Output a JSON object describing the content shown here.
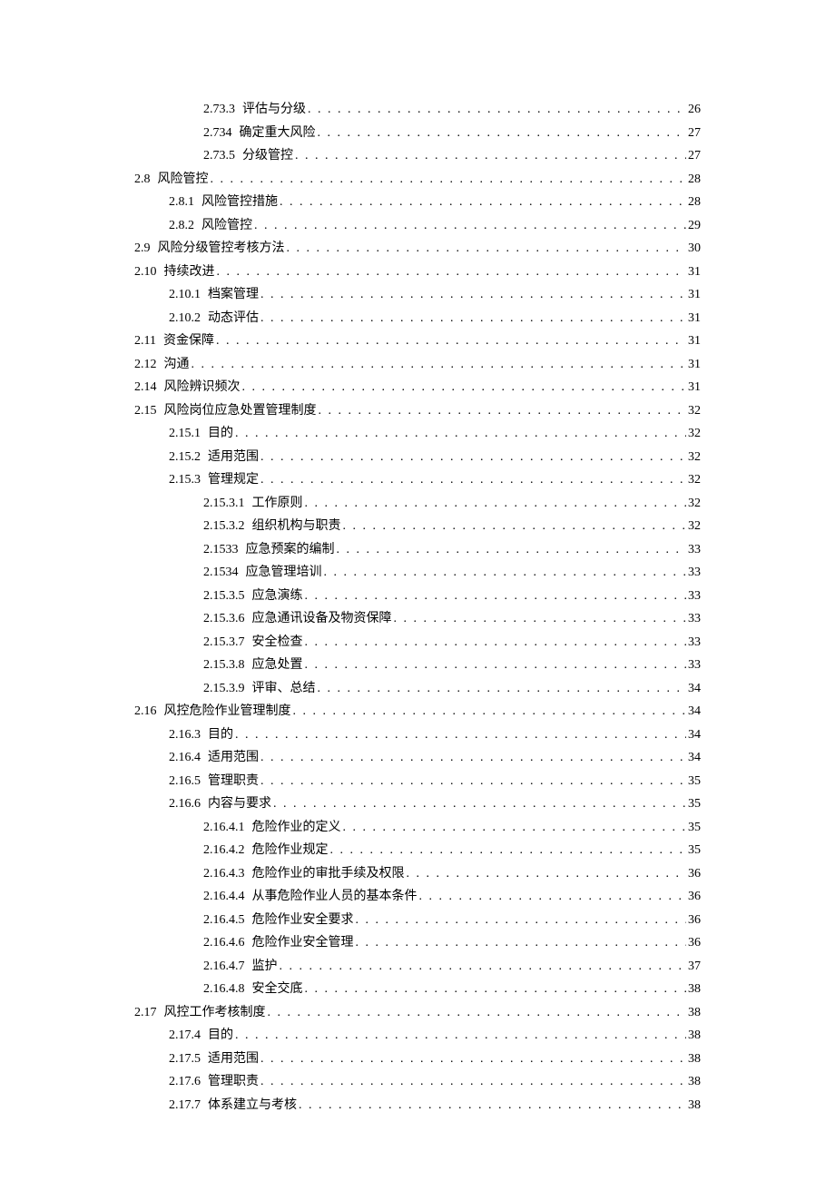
{
  "toc": [
    {
      "indent": 3,
      "num": "2.73.3",
      "title": "评估与分级",
      "page": "26"
    },
    {
      "indent": 3,
      "num": "2.734",
      "title": "确定重大风险",
      "page": "27"
    },
    {
      "indent": 3,
      "num": "2.73.5",
      "title": "分级管控",
      "page": "27"
    },
    {
      "indent": 1,
      "num": "2.8",
      "title": "风险管控",
      "page": "28"
    },
    {
      "indent": 2,
      "num": "2.8.1",
      "title": "风险管控措施",
      "page": "28"
    },
    {
      "indent": 2,
      "num": "2.8.2",
      "title": "风险管控",
      "page": "29"
    },
    {
      "indent": 1,
      "num": "2.9",
      "title": "风险分级管控考核方法",
      "page": "30"
    },
    {
      "indent": 1,
      "num": "2.10",
      "title": "持续改进",
      "page": "31"
    },
    {
      "indent": 2,
      "num": "2.10.1",
      "title": "档案管理",
      "page": "31"
    },
    {
      "indent": 2,
      "num": "2.10.2",
      "title": "动态评估",
      "page": "31"
    },
    {
      "indent": 1,
      "num": "2.11",
      "title": "资金保障",
      "page": "31"
    },
    {
      "indent": 1,
      "num": "2.12",
      "title": "沟通",
      "page": "31"
    },
    {
      "indent": 1,
      "num": "2.14",
      "title": "风险辨识频次",
      "page": "31"
    },
    {
      "indent": 1,
      "num": "2.15",
      "title": "风险岗位应急处置管理制度",
      "page": "32"
    },
    {
      "indent": 2,
      "num": "2.15.1",
      "title": "目的",
      "page": "32"
    },
    {
      "indent": 2,
      "num": "2.15.2",
      "title": "适用范围",
      "page": "32"
    },
    {
      "indent": 2,
      "num": "2.15.3",
      "title": "管理规定",
      "page": "32"
    },
    {
      "indent": 3,
      "num": "2.15.3.1",
      "title": "工作原则",
      "page": "32"
    },
    {
      "indent": 3,
      "num": "2.15.3.2",
      "title": "组织机构与职责",
      "page": "32"
    },
    {
      "indent": 3,
      "num": "2.1533",
      "title": "应急预案的编制",
      "page": "33"
    },
    {
      "indent": 3,
      "num": "2.1534",
      "title": "应急管理培训",
      "page": "33"
    },
    {
      "indent": 3,
      "num": "2.15.3.5",
      "title": "应急演练",
      "page": "33"
    },
    {
      "indent": 3,
      "num": "2.15.3.6",
      "title": "应急通讯设备及物资保障",
      "page": "33"
    },
    {
      "indent": 3,
      "num": "2.15.3.7",
      "title": "安全检查",
      "page": "33"
    },
    {
      "indent": 3,
      "num": "2.15.3.8",
      "title": "应急处置",
      "page": "33"
    },
    {
      "indent": 3,
      "num": "2.15.3.9",
      "title": "评审、总结",
      "page": "34"
    },
    {
      "indent": 1,
      "num": "2.16",
      "title": "风控危险作业管理制度",
      "page": "34"
    },
    {
      "indent": 2,
      "num": "2.16.3",
      "title": "目的",
      "page": "34"
    },
    {
      "indent": 2,
      "num": "2.16.4",
      "title": "适用范围",
      "page": "34"
    },
    {
      "indent": 2,
      "num": "2.16.5",
      "title": "管理职责",
      "page": "35"
    },
    {
      "indent": 2,
      "num": "2.16.6",
      "title": "内容与要求",
      "page": "35"
    },
    {
      "indent": 3,
      "num": "2.16.4.1",
      "title": "危险作业的定义",
      "page": "35"
    },
    {
      "indent": 3,
      "num": "2.16.4.2",
      "title": "危险作业规定",
      "page": "35"
    },
    {
      "indent": 3,
      "num": "2.16.4.3",
      "title": "危险作业的审批手续及权限",
      "page": "36"
    },
    {
      "indent": 3,
      "num": "2.16.4.4",
      "title": "从事危险作业人员的基本条件",
      "page": "36"
    },
    {
      "indent": 3,
      "num": "2.16.4.5",
      "title": "危险作业安全要求",
      "page": "36"
    },
    {
      "indent": 3,
      "num": "2.16.4.6",
      "title": "危险作业安全管理",
      "page": "36"
    },
    {
      "indent": 3,
      "num": "2.16.4.7",
      "title": "监护",
      "page": "37"
    },
    {
      "indent": 3,
      "num": "2.16.4.8",
      "title": "安全交底",
      "page": "38"
    },
    {
      "indent": 1,
      "num": "2.17",
      "title": "风控工作考核制度",
      "page": "38"
    },
    {
      "indent": 2,
      "num": "2.17.4",
      "title": "目的",
      "page": "38"
    },
    {
      "indent": 2,
      "num": "2.17.5",
      "title": "适用范围",
      "page": "38"
    },
    {
      "indent": 2,
      "num": "2.17.6",
      "title": "管理职责",
      "page": "38"
    },
    {
      "indent": 2,
      "num": "2.17.7",
      "title": "体系建立与考核",
      "page": "38"
    }
  ]
}
